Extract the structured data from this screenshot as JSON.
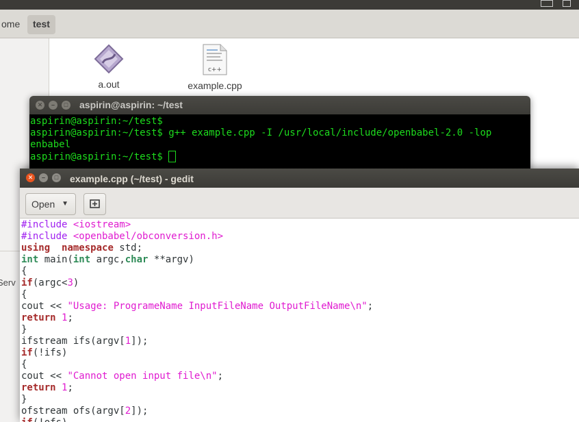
{
  "file_manager": {
    "breadcrumb_home": "ome",
    "breadcrumb_current": "test",
    "sidebar_partial": "Serv",
    "files": [
      {
        "name": "a.out",
        "icon": "executable-icon"
      },
      {
        "name": "example.cpp",
        "icon": "cpp-file-icon"
      }
    ]
  },
  "terminal": {
    "title": "aspirin@aspirin: ~/test",
    "lines": [
      "aspirin@aspirin:~/test$",
      "aspirin@aspirin:~/test$ g++ example.cpp -I /usr/local/include/openbabel-2.0 -lop",
      "enbabel",
      "aspirin@aspirin:~/test$ "
    ],
    "text_color": "#1ddc1d"
  },
  "gedit": {
    "title": "example.cpp (~/test) - gedit",
    "open_label": "Open",
    "code": [
      [
        [
          "pp",
          "#include "
        ],
        [
          "str",
          "<iostream>"
        ]
      ],
      [
        [
          "pp",
          "#include "
        ],
        [
          "str",
          "<openbabel/obconversion.h>"
        ]
      ],
      [
        [
          "kw",
          "using"
        ],
        [
          "",
          "  "
        ],
        [
          "kw",
          "namespace"
        ],
        [
          "",
          " std;"
        ]
      ],
      [
        [
          "ty",
          "int"
        ],
        [
          "",
          " main("
        ],
        [
          "ty",
          "int"
        ],
        [
          "",
          " argc,"
        ],
        [
          "ty",
          "char"
        ],
        [
          "",
          " **argv)"
        ]
      ],
      [
        [
          "",
          "{"
        ]
      ],
      [
        [
          "kw",
          "if"
        ],
        [
          "",
          "(argc<"
        ],
        [
          "num",
          "3"
        ],
        [
          "",
          ")"
        ]
      ],
      [
        [
          "",
          "{"
        ]
      ],
      [
        [
          "",
          "cout << "
        ],
        [
          "str",
          "\"Usage: ProgrameName InputFileName OutputFileName\\n\""
        ],
        [
          "",
          ";"
        ]
      ],
      [
        [
          "kw",
          "return"
        ],
        [
          "",
          " "
        ],
        [
          "num",
          "1"
        ],
        [
          "",
          ";"
        ]
      ],
      [
        [
          "",
          "}"
        ]
      ],
      [
        [
          "",
          "ifstream ifs(argv["
        ],
        [
          "num",
          "1"
        ],
        [
          "",
          "]);"
        ]
      ],
      [
        [
          "kw",
          "if"
        ],
        [
          "",
          "(!ifs)"
        ]
      ],
      [
        [
          "",
          "{"
        ]
      ],
      [
        [
          "",
          "cout << "
        ],
        [
          "str",
          "\"Cannot open input file\\n\""
        ],
        [
          "",
          ";"
        ]
      ],
      [
        [
          "kw",
          "return"
        ],
        [
          "",
          " "
        ],
        [
          "num",
          "1"
        ],
        [
          "",
          ";"
        ]
      ],
      [
        [
          "",
          "}"
        ]
      ],
      [
        [
          "",
          "ofstream ofs(argv["
        ],
        [
          "num",
          "2"
        ],
        [
          "",
          "]);"
        ]
      ],
      [
        [
          "kw",
          "if"
        ],
        [
          "",
          "(!ofs)"
        ]
      ]
    ]
  }
}
